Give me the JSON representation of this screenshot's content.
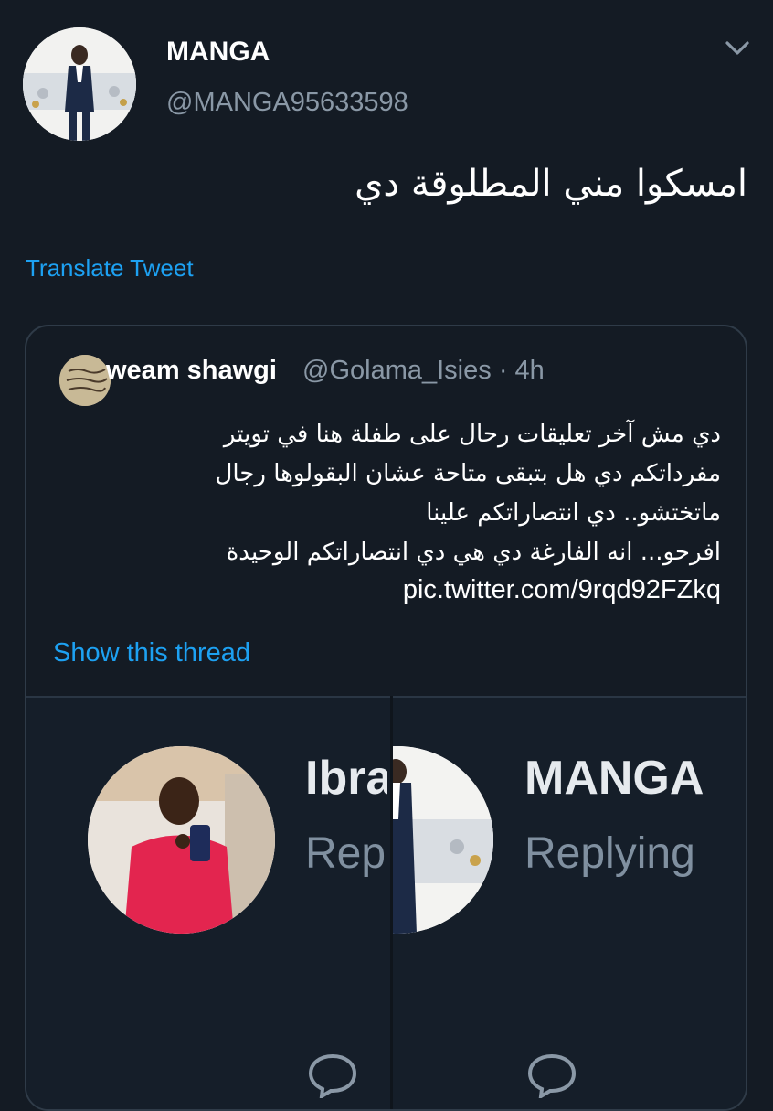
{
  "tweet": {
    "display_name": "MANGA",
    "handle": "@MANGA95633598",
    "text": "امسكوا مني المطلوقة دي",
    "translate_label": "Translate Tweet"
  },
  "quoted_tweet": {
    "display_name": "weam shawgi",
    "handle": "@Golama_Isies",
    "separator": "·",
    "time": "4h",
    "lines": [
      "دي مش آخر تعليقات رحال على طفلة هنا في تويتر",
      "مفرداتكم دي هل بتبقى متاحة عشان البقولوها رجال",
      "ماتختشو.. دي انتصاراتكم علينا",
      "افرحو... انه الفارغة دي هي دي انتصاراتكم الوحيدة"
    ],
    "link": "pic.twitter.com/9rqd92FZkq",
    "show_thread_label": "Show this thread"
  },
  "media": {
    "left": {
      "name": "Ibra",
      "replying": "Rep",
      "icon": "reply-icon"
    },
    "right": {
      "name": "MANGA",
      "replying": "Replying",
      "icon": "reply-icon"
    }
  },
  "colors": {
    "background": "#141b24",
    "link": "#1da1f2",
    "secondary_text": "#8a98a6",
    "border": "#2f3b48"
  }
}
